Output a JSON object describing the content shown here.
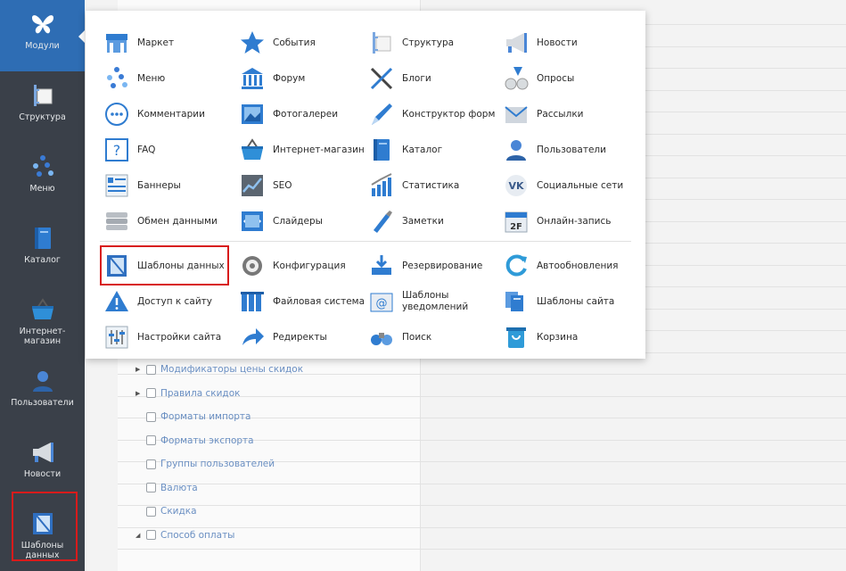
{
  "sidebar": {
    "items": [
      {
        "label": "Модули",
        "icon": "butterfly-icon",
        "active": true
      },
      {
        "label": "Структура",
        "icon": "structure-icon"
      },
      {
        "label": "Меню",
        "icon": "menu-tree-icon"
      },
      {
        "label": "Каталог",
        "icon": "book-icon"
      },
      {
        "label": "Интернет-магазин",
        "line1": "Интернет-",
        "line2": "магазин",
        "icon": "basket-icon"
      },
      {
        "label": "Пользователи",
        "icon": "user-icon"
      },
      {
        "label": "Новости",
        "icon": "megaphone-icon"
      },
      {
        "label": "Шаблоны данных",
        "line1": "Шаблоны",
        "line2": "данных",
        "icon": "data-template-icon"
      }
    ]
  },
  "modules": {
    "top": [
      [
        "Маркет",
        "События",
        "Структура",
        "Новости"
      ],
      [
        "Меню",
        "Форум",
        "Блоги",
        "Опросы"
      ],
      [
        "Комментарии",
        "Фотогалереи",
        "Конструктор форм",
        "Рассылки"
      ],
      [
        "FAQ",
        "Интернет-магазин",
        "Каталог",
        "Пользователи"
      ],
      [
        "Баннеры",
        "SEO",
        "Статистика",
        "Социальные сети"
      ],
      [
        "Обмен данными",
        "Слайдеры",
        "Заметки",
        "Онлайн-запись"
      ]
    ],
    "bottom": [
      [
        "Шаблоны данных",
        "Конфигурация",
        "Резервирование",
        "Автообновления"
      ],
      [
        "Доступ к сайту",
        "Файловая система",
        "Шаблоны уведомлений",
        "Шаблоны сайта"
      ],
      [
        "Настройки сайта",
        "Редиректы",
        "Поиск",
        "Корзина"
      ]
    ],
    "icons": {
      "Маркет": "market-icon",
      "События": "star-icon",
      "Структура": "structure-icon",
      "Новости": "megaphone-icon",
      "Меню": "menu-tree-icon",
      "Форум": "bank-icon",
      "Блоги": "pen-icon",
      "Опросы": "poll-icon",
      "Комментарии": "chat-bubble-icon",
      "Фотогалереи": "photo-icon",
      "Конструктор форм": "pencil-icon",
      "Рассылки": "envelope-icon",
      "FAQ": "question-icon",
      "Интернет-магазин": "basket-icon",
      "Каталог": "book-icon",
      "Пользователи": "user-icon",
      "Баннеры": "banner-icon",
      "SEO": "chart-icon",
      "Статистика": "stats-icon",
      "Социальные сети": "vk-icon",
      "Обмен данными": "database-icon",
      "Слайдеры": "slider-icon",
      "Заметки": "note-icon",
      "Онлайн-запись": "calendar-icon",
      "Шаблоны данных": "data-template-icon",
      "Конфигурация": "gear-icon",
      "Резервирование": "backup-icon",
      "Автообновления": "refresh-icon",
      "Доступ к сайту": "warning-icon",
      "Файловая система": "files-icon",
      "Шаблоны уведомлений": "mail-at-icon",
      "Шаблоны сайта": "templates-icon",
      "Настройки сайта": "settings-icon",
      "Редиректы": "redirect-arrow-icon",
      "Поиск": "binoculars-icon",
      "Корзина": "trash-icon"
    }
  },
  "tree": [
    {
      "label": "Модификаторы цены скидок",
      "expandable": true,
      "arrow": "▶"
    },
    {
      "label": "Правила скидок",
      "expandable": true,
      "arrow": "▶"
    },
    {
      "label": "Форматы импорта",
      "expandable": false
    },
    {
      "label": "Форматы экспорта",
      "expandable": false
    },
    {
      "label": "Группы пользователей",
      "expandable": false
    },
    {
      "label": "Валюта",
      "expandable": false
    },
    {
      "label": "Скидка",
      "expandable": false
    },
    {
      "label": "Способ оплаты",
      "expandable": true,
      "arrow": "◢"
    }
  ],
  "colors": {
    "sidebar_bg": "#3a4049",
    "sidebar_active": "#2e6db4",
    "highlight": "#d81b1b",
    "tree_link": "#6a8fc2"
  }
}
